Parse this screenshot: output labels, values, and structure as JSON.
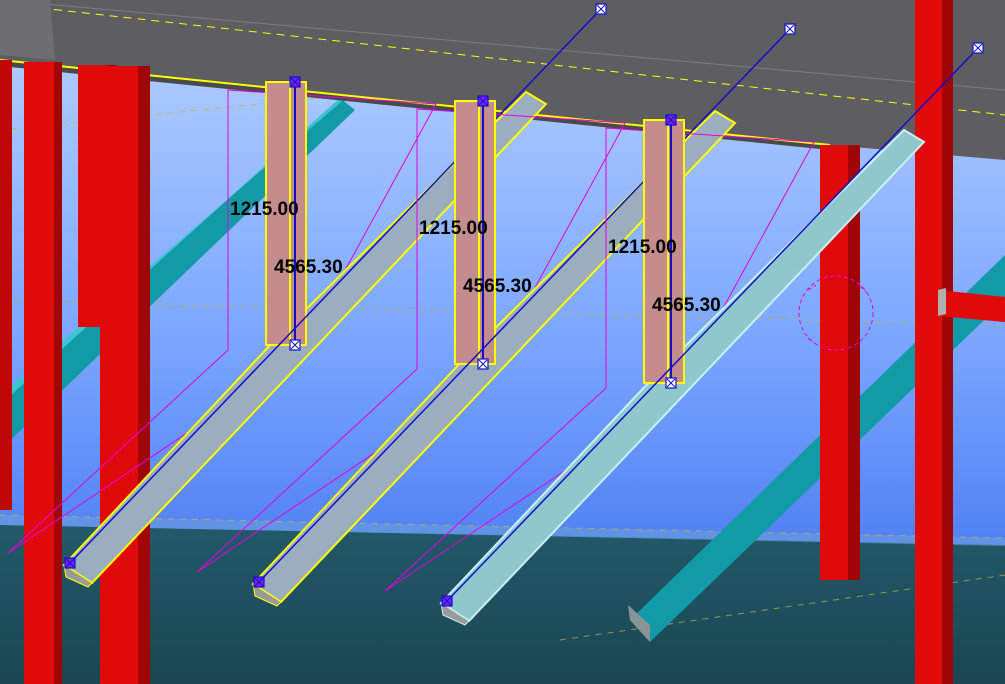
{
  "viewport": {
    "view_type": "3D model view",
    "colors": {
      "sky_top": "#a8c8ff",
      "sky_bottom": "#3d74ee",
      "floor": "#1e4f5c",
      "slab": "#5e5d62",
      "column": "#e00a0a",
      "brace": "#129aa6",
      "selected_outline": "#ffff00",
      "guide": "#e400e4",
      "reference_line": "#1010c8",
      "handle": "#7a1ef0",
      "post_fill": "#c48c8c"
    }
  },
  "selected_parts": [
    {
      "name": "selected-part-1",
      "height_label": "1215.00",
      "length_label": "4565.30"
    },
    {
      "name": "selected-part-2",
      "height_label": "1215.00",
      "length_label": "4565.30"
    },
    {
      "name": "selected-part-3",
      "height_label": "1215.00",
      "length_label": "4565.30"
    }
  ]
}
